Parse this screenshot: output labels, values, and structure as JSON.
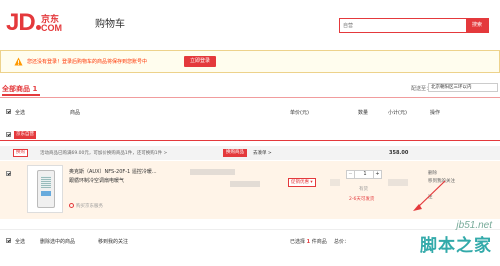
{
  "header": {
    "logo_jd": "JD",
    "logo_cn": "京东",
    "logo_com": "COM",
    "title": "购物车",
    "search_placeholder": "自营",
    "search_button": "搜索"
  },
  "notice": {
    "text": "您还没有登录！登录后购物车的商品将保存到您账号中",
    "login_button": "立即登录"
  },
  "tabs": {
    "all_label": "全部商品",
    "all_count": "1",
    "ship_to_label": "配送至：",
    "ship_to_value": "北京朝阳区三环以内"
  },
  "table_header": {
    "select_all": "全选",
    "product": "商品",
    "unit_price": "单价(元)",
    "quantity": "数量",
    "subtotal": "小计(元)",
    "action": "操作"
  },
  "shop": {
    "badge": "京东自营"
  },
  "promo": {
    "tag": "换购",
    "text": "活动商品已购满69.00元，可加价换购商品1件，还可换购1件 >",
    "button": "换购商品",
    "link": "去凑单 >",
    "sum": "358.00"
  },
  "item": {
    "name_line1": "奥克斯（AUX）NFS-20F-1 遥控冷暖...",
    "name_line2": "跟循环制冷空调扇电暖气",
    "service": "购买京东服务",
    "promo_dropdown": "促销优惠 ▾",
    "quantity": "1",
    "stock": "有货",
    "stock_note": "2-6天可发货",
    "action_delete": "删除",
    "action_fav": "移到我的关注",
    "action_more": "注"
  },
  "bottom": {
    "select_all": "全选",
    "delete_selected": "删除选中的商品",
    "move_to_fav": "移到我的关注",
    "selected_prefix": "已选择",
    "selected_count": "1",
    "selected_suffix": "件商品",
    "total_prefix": "总价："
  },
  "watermark": {
    "url": "jb51.net",
    "name": "脚本之家"
  }
}
